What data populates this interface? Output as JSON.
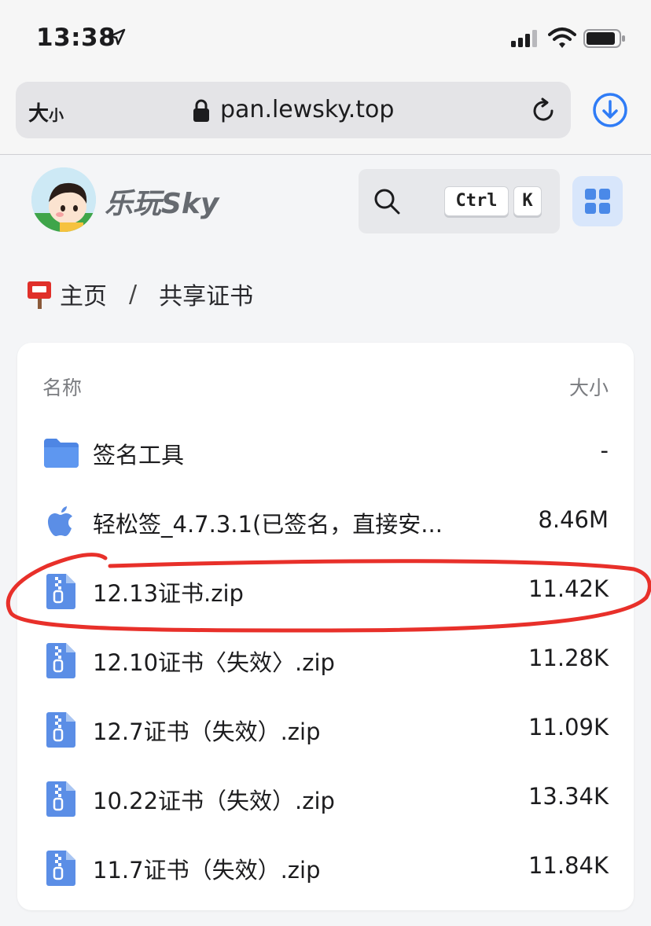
{
  "status_bar": {
    "time": "13:38"
  },
  "browser": {
    "text_size_label_big": "大",
    "text_size_label_small": "小",
    "url": "pan.lewsky.top"
  },
  "site": {
    "title": "乐玩Sky",
    "search_shortcut_ctrl": "Ctrl",
    "search_shortcut_key": "K"
  },
  "breadcrumb": {
    "home": "主页",
    "separator": "/",
    "current": "共享证书"
  },
  "file_list": {
    "header_name": "名称",
    "header_size": "大小",
    "rows": [
      {
        "name": "签名工具",
        "size": "-",
        "icon": "folder-icon"
      },
      {
        "name": "轻松签_4.7.3.1(已签名，直接安...",
        "size": "8.46M",
        "icon": "apple-icon"
      },
      {
        "name": "12.13证书.zip",
        "size": "11.42K",
        "icon": "zip-file-icon"
      },
      {
        "name": "12.10证书〈失效〉.zip",
        "size": "11.28K",
        "icon": "zip-file-icon"
      },
      {
        "name": "12.7证书（失效）.zip",
        "size": "11.09K",
        "icon": "zip-file-icon"
      },
      {
        "name": "10.22证书（失效）.zip",
        "size": "13.34K",
        "icon": "zip-file-icon"
      },
      {
        "name": "11.7证书（失效）.zip",
        "size": "11.84K",
        "icon": "zip-file-icon"
      }
    ]
  },
  "colors": {
    "accent": "#4a89e8",
    "annotation": "#e8302a"
  }
}
